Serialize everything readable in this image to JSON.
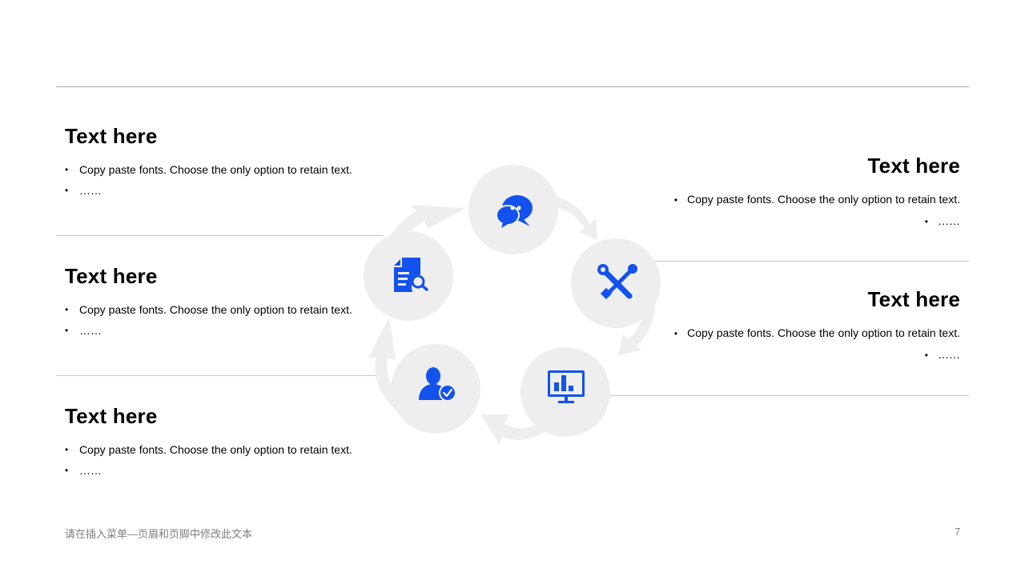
{
  "colors": {
    "accent": "#1452ee",
    "circle": "#eeeeee",
    "rule": "#c8c8c8",
    "footer": "#7f7f7f"
  },
  "left_blocks": [
    {
      "title": "Text here",
      "items": [
        "Copy paste fonts. Choose the only option to retain text.",
        "……"
      ]
    },
    {
      "title": "Text here",
      "items": [
        "Copy paste fonts. Choose the only option to retain text.",
        "……"
      ]
    },
    {
      "title": "Text here",
      "items": [
        "Copy paste fonts. Choose the only option to retain text.",
        "……"
      ]
    }
  ],
  "right_blocks": [
    {
      "title": "Text here",
      "items": [
        "Copy paste fonts. Choose the only option to retain text.",
        "……"
      ]
    },
    {
      "title": "Text here",
      "items": [
        "Copy paste fonts. Choose the only option to retain text.",
        "……"
      ]
    }
  ],
  "cycle": {
    "icons": [
      "chat-bubbles-icon",
      "tools-icon",
      "chart-monitor-icon",
      "user-check-icon",
      "document-search-icon"
    ]
  },
  "footer": {
    "text": "请在插入菜单—页眉和页脚中修改此文本",
    "page_number": "7"
  }
}
